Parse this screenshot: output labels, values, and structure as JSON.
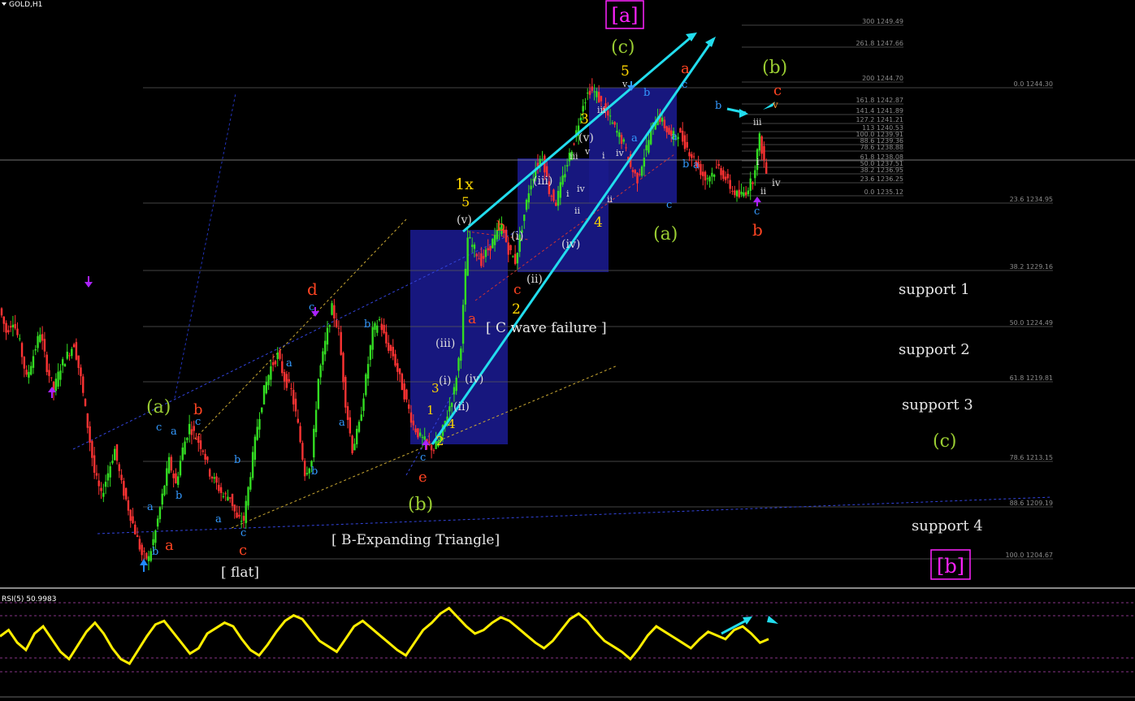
{
  "window": {
    "symbol_title": "GOLD,H1",
    "indicator_title": "RSI(5) 50.9983"
  },
  "colors": {
    "background": "#000000",
    "bull_candle": "#33dd22",
    "bear_candle": "#ff3333",
    "rsi_line": "#ffee00",
    "trendline": "#22ddee",
    "box_fill": "#1a1a8c",
    "wave_green": "#9acd32",
    "wave_orange": "#ff4422",
    "wave_blue": "#3399ff",
    "wave_yellow": "#ffd700",
    "wave_white": "#dddddd",
    "wave_magenta": "#ff22ff",
    "arrow_purple": "#aa22ff"
  },
  "fibonacci_levels": [
    {
      "label": "300 1249.49"
    },
    {
      "label": "261.8 1247.66"
    },
    {
      "label": "200 1244.70"
    },
    {
      "label": "0.0 1244.30"
    },
    {
      "label": "161.8 1242.87"
    },
    {
      "label": "141.4 1241.89"
    },
    {
      "label": "127.2 1241.21"
    },
    {
      "label": "113 1240.53"
    },
    {
      "label": "100.0 1239.91"
    },
    {
      "label": "88.6 1239.36"
    },
    {
      "label": "78.6 1238.88"
    },
    {
      "label": "61.8 1238.08"
    },
    {
      "label": "50.0 1237.51"
    },
    {
      "label": "38.2 1236.95"
    },
    {
      "label": "23.6 1236.25"
    },
    {
      "label": "0.0 1235.12"
    },
    {
      "label": "23.6 1234.95"
    },
    {
      "label": "38.2 1229.16"
    },
    {
      "label": "50.0 1224.49"
    },
    {
      "label": "61.8 1219.81"
    },
    {
      "label": "78.6 1213.15"
    },
    {
      "label": "88.6 1209.19"
    },
    {
      "label": "100.0 1204.67"
    }
  ],
  "annotations": {
    "support_1": "support 1",
    "support_2": "support 2",
    "support_3": "support 3",
    "support_4": "support 4",
    "flat": "[ flat]",
    "b_expanding_triangle": "[ B-Expanding Triangle]",
    "c_wave_failure": "[ C wave failure ]",
    "bracket_a": "[a]",
    "bracket_b": "[b]",
    "label_1x": "1x"
  },
  "wave_labels": [
    {
      "text": "(a)",
      "color": "green"
    },
    {
      "text": "(b)",
      "color": "green"
    },
    {
      "text": "(c)",
      "color": "green"
    },
    {
      "text": "(a)",
      "color": "green"
    },
    {
      "text": "(b)",
      "color": "green"
    },
    {
      "text": "(c)",
      "color": "green"
    },
    {
      "text": "a",
      "color": "orange"
    },
    {
      "text": "b",
      "color": "orange"
    },
    {
      "text": "c",
      "color": "orange"
    },
    {
      "text": "d",
      "color": "orange"
    },
    {
      "text": "e",
      "color": "orange"
    },
    {
      "text": "a",
      "color": "orange"
    },
    {
      "text": "b",
      "color": "orange"
    },
    {
      "text": "c",
      "color": "orange"
    },
    {
      "text": "a",
      "color": "orange"
    },
    {
      "text": "b",
      "color": "orange"
    },
    {
      "text": "c",
      "color": "orange"
    },
    {
      "text": "1",
      "color": "yellow"
    },
    {
      "text": "2",
      "color": "yellow"
    },
    {
      "text": "3",
      "color": "yellow"
    },
    {
      "text": "4",
      "color": "yellow"
    },
    {
      "text": "5",
      "color": "yellow"
    },
    {
      "text": "2",
      "color": "yellow"
    },
    {
      "text": "3",
      "color": "yellow"
    },
    {
      "text": "4",
      "color": "yellow"
    },
    {
      "text": "5",
      "color": "yellow"
    },
    {
      "text": "5",
      "color": "yellow"
    },
    {
      "text": "(i)",
      "color": "white"
    },
    {
      "text": "(ii)",
      "color": "white"
    },
    {
      "text": "(iii)",
      "color": "white"
    },
    {
      "text": "(iv)",
      "color": "white"
    },
    {
      "text": "(v)",
      "color": "white"
    },
    {
      "text": "(i)",
      "color": "white"
    },
    {
      "text": "(ii)",
      "color": "white"
    },
    {
      "text": "(iii)",
      "color": "white"
    },
    {
      "text": "(iv)",
      "color": "white"
    },
    {
      "text": "(v)",
      "color": "white"
    },
    {
      "text": "i",
      "color": "white"
    },
    {
      "text": "ii",
      "color": "white"
    },
    {
      "text": "iii",
      "color": "white"
    },
    {
      "text": "iv",
      "color": "white"
    },
    {
      "text": "v",
      "color": "white"
    },
    {
      "text": "i",
      "color": "white"
    },
    {
      "text": "ii",
      "color": "white"
    },
    {
      "text": "iii",
      "color": "white"
    },
    {
      "text": "iv",
      "color": "white"
    },
    {
      "text": "v",
      "color": "white"
    },
    {
      "text": "i",
      "color": "white"
    },
    {
      "text": "ii",
      "color": "white"
    },
    {
      "text": "iii",
      "color": "white"
    },
    {
      "text": "iv",
      "color": "white"
    },
    {
      "text": "v",
      "color": "orange"
    },
    {
      "text": "a",
      "color": "blue"
    },
    {
      "text": "b",
      "color": "blue"
    },
    {
      "text": "c",
      "color": "blue"
    }
  ],
  "chart_data": {
    "type": "candlestick",
    "symbol": "GOLD",
    "timeframe": "H1",
    "price_levels_shown": [
      1249.49,
      1247.66,
      1244.7,
      1244.3,
      1242.87,
      1241.89,
      1241.21,
      1240.53,
      1239.91,
      1239.36,
      1238.88,
      1238.08,
      1237.51,
      1236.95,
      1236.25,
      1235.12,
      1234.95,
      1229.16,
      1224.49,
      1219.81,
      1213.15,
      1209.19,
      1204.67
    ],
    "price_path": [
      1226,
      1224,
      1225,
      1223,
      1220,
      1222,
      1224,
      1221,
      1219,
      1221,
      1222,
      1223,
      1220,
      1216,
      1212,
      1210,
      1212,
      1214,
      1211,
      1209,
      1207,
      1205,
      1204.7,
      1207,
      1210,
      1213,
      1211,
      1214,
      1216,
      1215,
      1214,
      1212,
      1211,
      1210,
      1210,
      1208,
      1208,
      1212,
      1216,
      1219,
      1221,
      1222,
      1220,
      1219,
      1216,
      1212,
      1213,
      1220,
      1223,
      1226,
      1224,
      1218,
      1214,
      1216,
      1220,
      1224,
      1225,
      1223,
      1222,
      1220,
      1218,
      1216,
      1215,
      1214.5,
      1214,
      1215,
      1217,
      1219,
      1223,
      1232,
      1231,
      1230,
      1231,
      1232,
      1233,
      1231,
      1230,
      1233,
      1236,
      1238,
      1239,
      1236,
      1235,
      1237,
      1239,
      1241,
      1243.5,
      1244.6,
      1244.2,
      1243,
      1242,
      1241,
      1240,
      1238,
      1237,
      1239,
      1241,
      1242.5,
      1241.5,
      1240.5,
      1241,
      1240,
      1239,
      1238,
      1237,
      1237.5,
      1238,
      1237,
      1236,
      1235.5,
      1236,
      1237,
      1240.5,
      1237.5
    ],
    "rsi": {
      "period": 5,
      "last_value": 50.9983,
      "values": [
        55,
        62,
        48,
        40,
        58,
        66,
        52,
        38,
        30,
        45,
        60,
        70,
        58,
        42,
        30,
        25,
        40,
        55,
        68,
        72,
        60,
        48,
        36,
        42,
        58,
        64,
        70,
        66,
        52,
        40,
        34,
        46,
        60,
        72,
        78,
        74,
        62,
        50,
        44,
        38,
        52,
        66,
        72,
        64,
        56,
        48,
        40,
        34,
        48,
        62,
        70,
        80,
        86,
        76,
        66,
        58,
        62,
        70,
        76,
        72,
        64,
        56,
        48,
        42,
        50,
        62,
        74,
        80,
        72,
        60,
        50,
        44,
        38,
        30,
        42,
        56,
        66,
        60,
        54,
        48,
        42,
        52,
        60,
        56,
        52,
        62,
        66,
        58,
        48,
        52
      ]
    }
  }
}
